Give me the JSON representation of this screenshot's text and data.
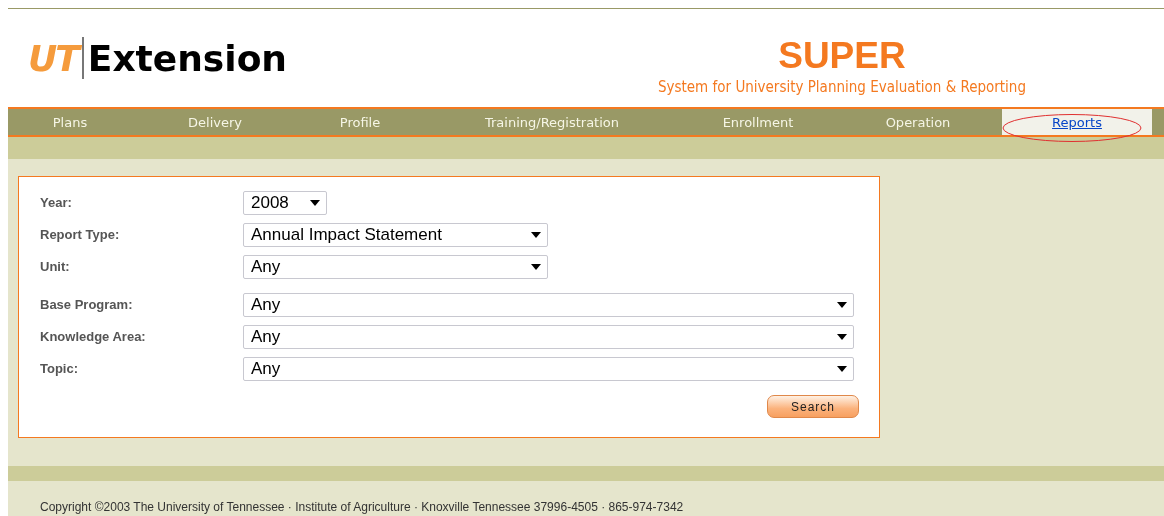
{
  "header": {
    "logo_mark": "UT",
    "logo_text": "Extension",
    "app_name": "SUPER",
    "app_subtitle": "System for University Planning Evaluation & Reporting"
  },
  "nav": [
    {
      "label": "Plans",
      "selected": false
    },
    {
      "label": "Delivery",
      "selected": false
    },
    {
      "label": "Profile",
      "selected": false
    },
    {
      "label": "Training/Registration",
      "selected": false
    },
    {
      "label": "Enrollment",
      "selected": false
    },
    {
      "label": "Operation",
      "selected": false
    },
    {
      "label": "Reports",
      "selected": true
    }
  ],
  "form": {
    "fields": [
      {
        "label": "Year:",
        "value": "2008"
      },
      {
        "label": "Report Type:",
        "value": "Annual Impact Statement"
      },
      {
        "label": "Unit:",
        "value": "Any"
      },
      {
        "label": "Base Program:",
        "value": "Any"
      },
      {
        "label": "Knowledge Area:",
        "value": "Any"
      },
      {
        "label": "Topic:",
        "value": "Any"
      }
    ],
    "submit": "Search"
  },
  "footer": "Copyright ©2003 The University of Tennessee · Institute of Agriculture · Knoxville Tennessee 37996-4505 · 865-974-7342"
}
